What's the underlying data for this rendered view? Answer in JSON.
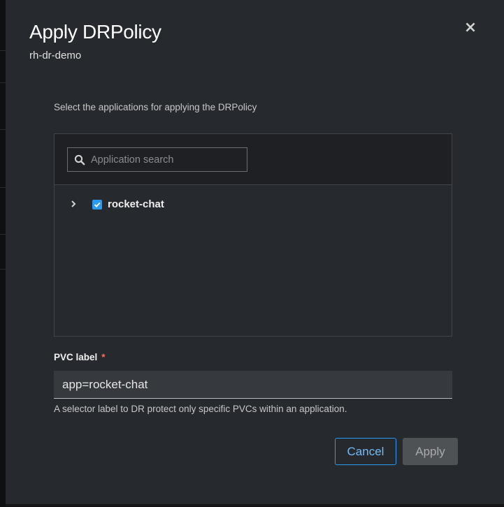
{
  "modal": {
    "title": "Apply DRPolicy",
    "subtitle": "rh-dr-demo",
    "close_icon": "close-icon"
  },
  "applications": {
    "instruction": "Select the applications for applying the DRPolicy",
    "search": {
      "placeholder": "Application search",
      "value": "",
      "icon": "search-icon"
    },
    "tree": [
      {
        "label": "rocket-chat",
        "checked": true,
        "expand_icon": "chevron-right-icon"
      }
    ]
  },
  "pvc": {
    "label": "PVC label",
    "required_marker": "*",
    "value": "app=rocket-chat",
    "helper": "A selector label to DR protect only specific PVCs within an application."
  },
  "footer": {
    "cancel_label": "Cancel",
    "apply_label": "Apply"
  },
  "colors": {
    "modal_bg": "#26292d",
    "accent": "#2b9af3",
    "required": "#ff6b5b"
  }
}
